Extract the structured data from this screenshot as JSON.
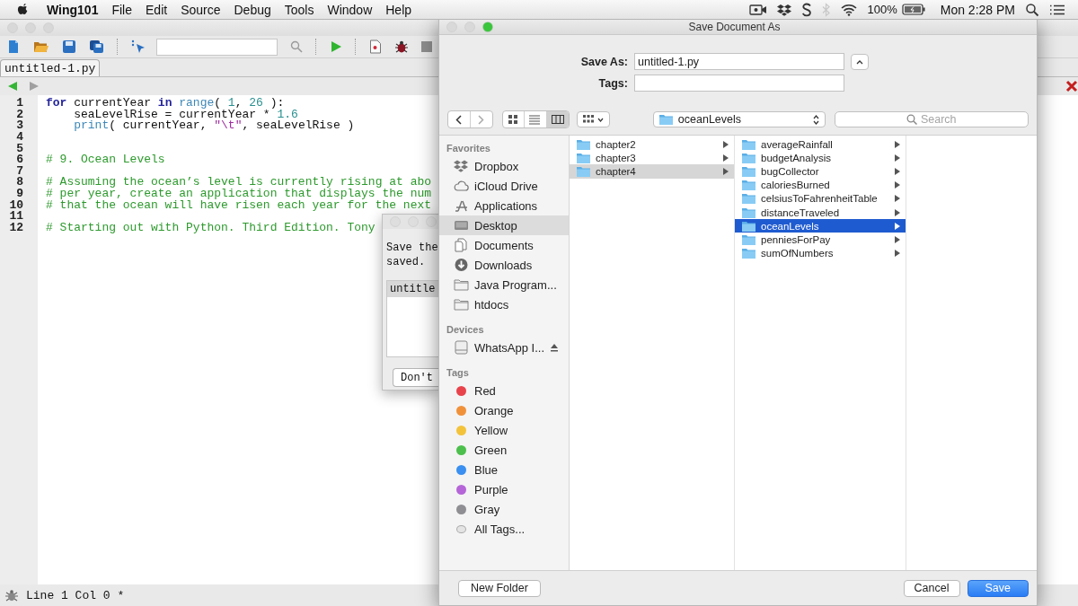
{
  "menubar": {
    "app": "Wing101",
    "menus": [
      "File",
      "Edit",
      "Source",
      "Debug",
      "Tools",
      "Window",
      "Help"
    ],
    "battery": "100%",
    "clock": "Mon 2:28 PM"
  },
  "editor": {
    "tab": "untitled-1.py",
    "lines": [
      {
        "number": "1",
        "tokens": [
          {
            "kind": "keyword",
            "text": "for"
          },
          {
            "kind": "plain",
            "text": " currentYear "
          },
          {
            "kind": "keyword",
            "text": "in"
          },
          {
            "kind": "builtin",
            "text": " range"
          },
          {
            "kind": "plain",
            "text": "( "
          },
          {
            "kind": "number",
            "text": "1"
          },
          {
            "kind": "plain",
            "text": ", "
          },
          {
            "kind": "number",
            "text": "26"
          },
          {
            "kind": "plain",
            "text": " ):"
          }
        ]
      },
      {
        "number": "2",
        "tokens": [
          {
            "kind": "plain",
            "text": "    seaLevelRise = currentYear * "
          },
          {
            "kind": "number",
            "text": "1.6"
          }
        ]
      },
      {
        "number": "3",
        "tokens": [
          {
            "kind": "builtin",
            "text": "    print"
          },
          {
            "kind": "plain",
            "text": "( currentYear, "
          },
          {
            "kind": "string",
            "text": "\"\\t\""
          },
          {
            "kind": "plain",
            "text": ", seaLevelRise )"
          }
        ]
      },
      {
        "number": "4"
      },
      {
        "number": "5"
      },
      {
        "number": "6",
        "tokens": [
          {
            "kind": "comment",
            "text": "# 9. Ocean Levels"
          }
        ]
      },
      {
        "number": "7"
      },
      {
        "number": "8",
        "tokens": [
          {
            "kind": "comment",
            "text": "# Assuming the ocean’s level is currently rising at abo"
          }
        ]
      },
      {
        "number": "9",
        "tokens": [
          {
            "kind": "comment",
            "text": "# per year, create an application that displays the num"
          }
        ]
      },
      {
        "number": "10",
        "tokens": [
          {
            "kind": "comment",
            "text": "# that the ocean will have risen each year for the next"
          }
        ]
      },
      {
        "number": "11"
      },
      {
        "number": "12",
        "tokens": [
          {
            "kind": "comment",
            "text": "# Starting out with Python. Third Edition. Tony"
          }
        ]
      }
    ],
    "status": "Line 1 Col 0 *"
  },
  "prompt_dialog": {
    "message_lines": [
      "Save the",
      "saved."
    ],
    "files": [
      {
        "name": "untitle",
        "selected": true
      }
    ],
    "button": "Don't"
  },
  "save_dialog": {
    "title": "Save Document As",
    "save_as_label": "Save As:",
    "save_as_value": "untitled-1.py",
    "tags_label": "Tags:",
    "view_buttons": [
      {
        "selected": false
      },
      {
        "selected": false
      },
      {
        "selected": true
      }
    ],
    "location": "oceanLevels",
    "search_placeholder": "Search",
    "sidebar": [
      {
        "heading": "Favorites",
        "items": [
          {
            "kind": "place",
            "label": "Dropbox",
            "selected": false
          },
          {
            "kind": "place",
            "label": "iCloud Drive",
            "selected": false
          },
          {
            "kind": "place",
            "label": "Applications",
            "selected": false
          },
          {
            "kind": "place",
            "label": "Desktop",
            "selected": true
          },
          {
            "kind": "place",
            "label": "Documents",
            "selected": false
          },
          {
            "kind": "place",
            "label": "Downloads",
            "selected": false
          },
          {
            "kind": "place",
            "label": "Java Program...",
            "selected": false
          },
          {
            "kind": "place",
            "label": "htdocs",
            "selected": false
          }
        ]
      },
      {
        "heading": "Devices",
        "items": [
          {
            "kind": "device",
            "label": "WhatsApp I...",
            "selected": false
          }
        ]
      },
      {
        "heading": "Tags",
        "items": [
          {
            "kind": "tag",
            "label": "Red",
            "selected": false,
            "color": "#e8434b"
          },
          {
            "kind": "tag",
            "label": "Orange",
            "selected": false,
            "color": "#f0913a"
          },
          {
            "kind": "tag",
            "label": "Yellow",
            "selected": false,
            "color": "#f3c33c"
          },
          {
            "kind": "tag",
            "label": "Green",
            "selected": false,
            "color": "#4cbf4c"
          },
          {
            "kind": "tag",
            "label": "Blue",
            "selected": false,
            "color": "#3a8ff0"
          },
          {
            "kind": "tag",
            "label": "Purple",
            "selected": false,
            "color": "#b565d8"
          },
          {
            "kind": "tag",
            "label": "Gray",
            "selected": false,
            "color": "#8e8e93"
          },
          {
            "kind": "all-tags",
            "label": "All Tags...",
            "selected": false
          }
        ]
      }
    ],
    "columns": [
      {
        "focused": false,
        "items": [
          {
            "label": "chapter2",
            "selected": false
          },
          {
            "label": "chapter3",
            "selected": false
          },
          {
            "label": "chapter4",
            "selected": true
          }
        ]
      },
      {
        "focused": true,
        "items": [
          {
            "label": "averageRainfall",
            "selected": false
          },
          {
            "label": "budgetAnalysis",
            "selected": false
          },
          {
            "label": "bugCollector",
            "selected": false
          },
          {
            "label": "caloriesBurned",
            "selected": false
          },
          {
            "label": "celsiusToFahrenheitTable",
            "selected": false
          },
          {
            "label": "distanceTraveled",
            "selected": false
          },
          {
            "label": "oceanLevels",
            "selected": true
          },
          {
            "label": "penniesForPay",
            "selected": false
          },
          {
            "label": "sumOfNumbers",
            "selected": false
          }
        ]
      }
    ],
    "buttons": {
      "new_folder": "New Folder",
      "cancel": "Cancel",
      "save": "Save"
    }
  }
}
